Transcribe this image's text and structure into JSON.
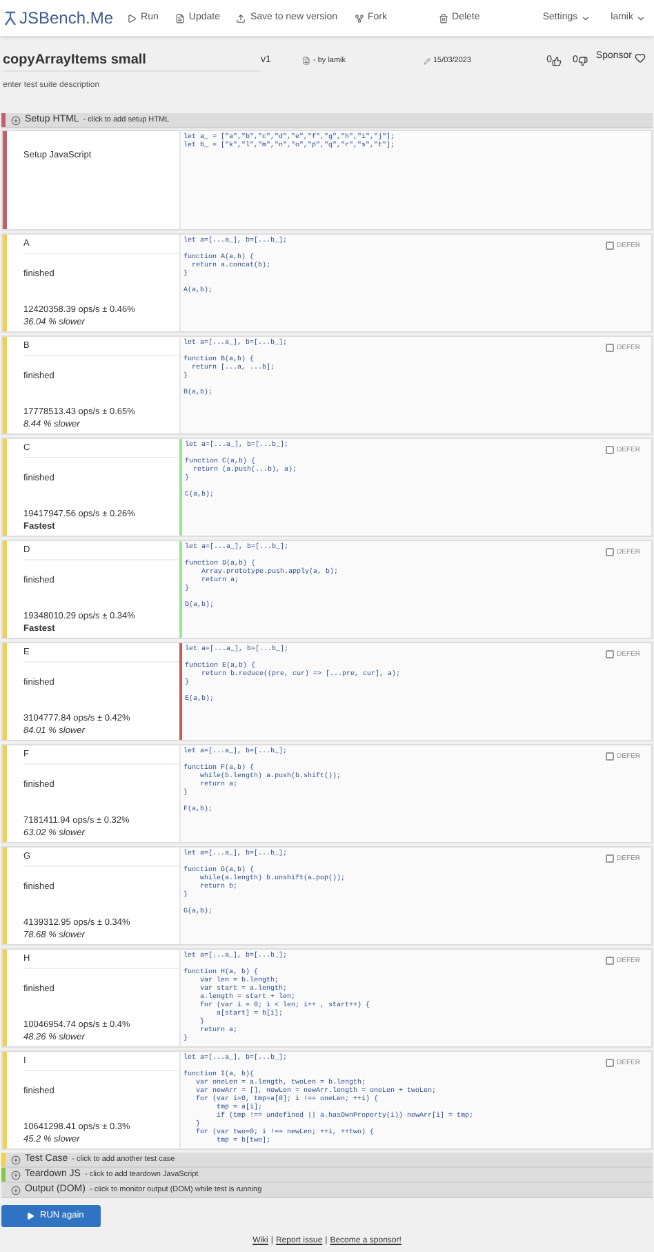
{
  "header": {
    "logo": "JSBench.Me",
    "actions": [
      {
        "kind": "run",
        "label": "Run"
      },
      {
        "kind": "update",
        "label": "Update"
      },
      {
        "kind": "save",
        "label": "Save to new version"
      },
      {
        "kind": "fork",
        "label": "Fork"
      },
      {
        "kind": "delete",
        "label": "Delete"
      }
    ],
    "menus": [
      "Settings",
      "lamik"
    ]
  },
  "suite": {
    "title": "copyArrayItems small",
    "version": "v1",
    "author": "- by lamik",
    "date": "15/03/2023",
    "likes": "0",
    "dislikes": "0",
    "sponsor": "Sponsor",
    "description_placeholder": "enter test suite description"
  },
  "setup_html": {
    "label": "Setup HTML",
    "hint": "- click to add setup HTML"
  },
  "setup_js": {
    "label": "Setup JavaScript",
    "code": "let a_ = [\"a\",\"b\",\"c\",\"d\",\"e\",\"f\",\"g\",\"h\",\"i\",\"j\"];\nlet b_ = [\"k\",\"l\",\"m\",\"n\",\"o\",\"p\",\"q\",\"r\",\"s\",\"t\"];"
  },
  "tests": [
    {
      "name": "A",
      "status": "finished",
      "ops": "12420358.39 ops/s ± 0.46%",
      "result": "36.04 % slower",
      "kind": "slower",
      "defer_label": "DEFER",
      "defer": false,
      "code": "let a=[...a_], b=[...b_];\n\nfunction A(a,b) {\n  return a.concat(b);\n}\n\nA(a,b);"
    },
    {
      "name": "B",
      "status": "finished",
      "ops": "17778513.43 ops/s ± 0.65%",
      "result": "8.44 % slower",
      "kind": "slower",
      "defer_label": "DEFER",
      "defer": false,
      "code": "let a=[...a_], b=[...b_];\n\nfunction B(a,b) {\n  return [...a, ...b];\n}\n\nB(a,b);"
    },
    {
      "name": "C",
      "status": "finished",
      "ops": "19417947.56 ops/s ± 0.26%",
      "result": "Fastest",
      "kind": "fastest",
      "defer_label": "DEFER",
      "defer": false,
      "code": "let a=[...a_], b=[...b_];\n\nfunction C(a,b) {\n  return (a.push(...b), a);\n}\n\nC(a,b);"
    },
    {
      "name": "D",
      "status": "finished",
      "ops": "19348010.29 ops/s ± 0.34%",
      "result": "Fastest",
      "kind": "fastest",
      "defer_label": "DEFER",
      "defer": false,
      "code": "let a=[...a_], b=[...b_];\n\nfunction D(a,b) {\n    Array.prototype.push.apply(a, b);\n    return a;\n}\n\nD(a,b);"
    },
    {
      "name": "E",
      "status": "finished",
      "ops": "3104777.84 ops/s ± 0.42%",
      "result": "84.01 % slower",
      "kind": "slowest",
      "defer_label": "DEFER",
      "defer": false,
      "code": "let a=[...a_], b=[...b_];\n\nfunction E(a,b) {\n    return b.reduce((pre, cur) => [...pre, cur], a);\n}\n\nE(a,b);"
    },
    {
      "name": "F",
      "status": "finished",
      "ops": "7181411.94 ops/s ± 0.32%",
      "result": "63.02 % slower",
      "kind": "slower",
      "defer_label": "DEFER",
      "defer": false,
      "code": "let a=[...a_], b=[...b_];\n\nfunction F(a,b) {\n    while(b.length) a.push(b.shift());\n    return a;\n}\n\nF(a,b);"
    },
    {
      "name": "G",
      "status": "finished",
      "ops": "4139312.95 ops/s ± 0.34%",
      "result": "78.68 % slower",
      "kind": "slower",
      "defer_label": "DEFER",
      "defer": false,
      "code": "let a=[...a_], b=[...b_];\n\nfunction G(a,b) {\n    while(a.length) b.unshift(a.pop());\n    return b;\n}\n\nG(a,b);"
    },
    {
      "name": "H",
      "status": "finished",
      "ops": "10046954.74 ops/s ± 0.4%",
      "result": "48.26 % slower",
      "kind": "slower",
      "defer_label": "DEFER",
      "defer": false,
      "code": "let a=[...a_], b=[...b_];\n\nfunction H(a, b) {\n    var len = b.length;\n    var start = a.length;\n    a.length = start + len;\n    for (var i = 0; i < len; i++ , start++) {\n        a[start] = b[i];\n    }\n    return a;\n}"
    },
    {
      "name": "I",
      "status": "finished",
      "ops": "10641298.41 ops/s ± 0.3%",
      "result": "45.2 % slower",
      "kind": "slower",
      "defer_label": "DEFER",
      "defer": false,
      "code": "let a=[...a_], b=[...b_];\n\nfunction I(a, b){\n   var oneLen = a.length, twoLen = b.length;\n   var newArr = [], newLen = newArr.length = oneLen + twoLen;\n   for (var i=0, tmp=a[0]; i !== oneLen; ++i) {\n        tmp = a[i];\n        if (tmp !== undefined || a.hasOwnProperty(i)) newArr[i] = tmp;\n   }\n   for (var two=0; i !== newLen; ++i, ++two) {\n        tmp = b[two];"
    }
  ],
  "sections": [
    {
      "kind": "test",
      "label": "Test Case",
      "hint": "- click to add another test case"
    },
    {
      "kind": "teardown",
      "label": "Teardown JS",
      "hint": "- click to add teardown JavaScript"
    },
    {
      "kind": "output",
      "label": "Output (DOM)",
      "hint": "- click to monitor output (DOM) while test is running"
    }
  ],
  "run_button": "RUN again",
  "footer": {
    "links": [
      "Wiki",
      "Report issue",
      "Become a sponsor!"
    ],
    "separator": "|"
  }
}
